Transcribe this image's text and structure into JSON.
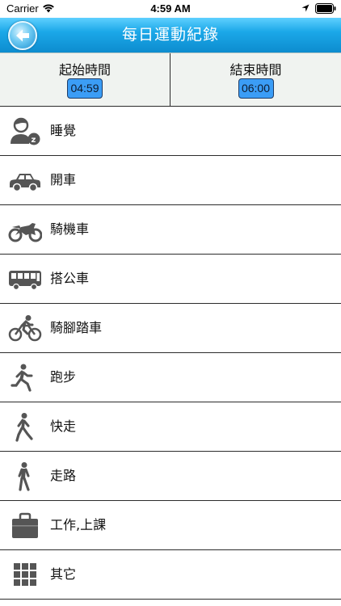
{
  "status_bar": {
    "carrier": "Carrier",
    "time": "4:59 AM"
  },
  "nav": {
    "title": "每日運動紀錄",
    "back_icon": "back-arrow-icon"
  },
  "time_panel": {
    "start_label": "起始時間",
    "start_value": "04:59",
    "end_label": "結束時間",
    "end_value": "06:00"
  },
  "activities": [
    {
      "label": "睡覺",
      "icon": "sleep-icon"
    },
    {
      "label": "開車",
      "icon": "car-icon"
    },
    {
      "label": "騎機車",
      "icon": "motorcycle-icon"
    },
    {
      "label": "搭公車",
      "icon": "bus-icon"
    },
    {
      "label": "騎腳踏車",
      "icon": "bicycle-icon"
    },
    {
      "label": "跑步",
      "icon": "running-icon"
    },
    {
      "label": "快走",
      "icon": "brisk-walk-icon"
    },
    {
      "label": "走路",
      "icon": "walking-icon"
    },
    {
      "label": "工作,上課",
      "icon": "briefcase-icon"
    },
    {
      "label": "其它",
      "icon": "grid-icon"
    }
  ],
  "colors": {
    "nav_blue": "#1ba8e8",
    "time_box": "#3b9df6",
    "icon_gray": "#555555"
  }
}
